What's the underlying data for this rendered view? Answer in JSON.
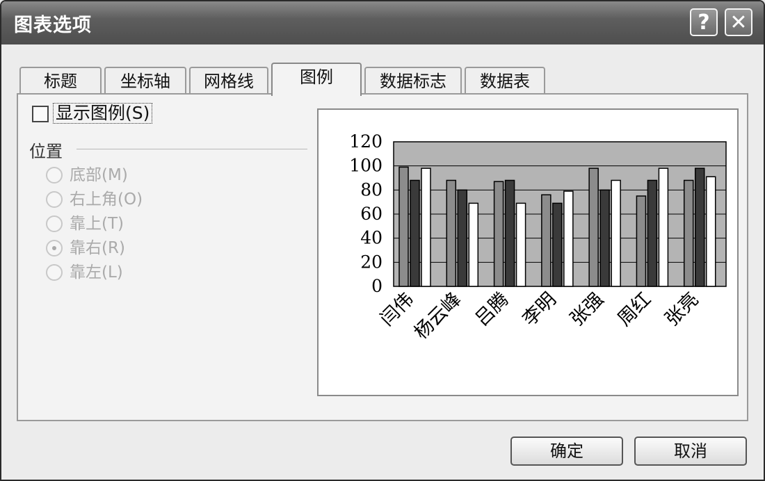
{
  "window": {
    "title": "图表选项",
    "help_glyph": "?",
    "close_glyph": "✕"
  },
  "tabs": [
    {
      "label": "标题"
    },
    {
      "label": "坐标轴"
    },
    {
      "label": "网格线"
    },
    {
      "label": "图例",
      "active": true
    },
    {
      "label": "数据标志"
    },
    {
      "label": "数据表"
    }
  ],
  "legend": {
    "show_label": "显示图例(S)",
    "show_checked": false,
    "position_label": "位置",
    "options": [
      {
        "label": "底部(M)",
        "selected": false
      },
      {
        "label": "右上角(O)",
        "selected": false
      },
      {
        "label": "靠上(T)",
        "selected": false
      },
      {
        "label": "靠右(R)",
        "selected": true
      },
      {
        "label": "靠左(L)",
        "selected": false
      }
    ]
  },
  "chart_data": {
    "type": "bar",
    "categories": [
      "闫伟",
      "杨云峰",
      "吕腾",
      "李明",
      "张强",
      "周红",
      "张亮"
    ],
    "series": [
      {
        "values": [
          99,
          88,
          87,
          76,
          98,
          75,
          88
        ],
        "color": "#8c8c8c"
      },
      {
        "values": [
          88,
          80,
          88,
          69,
          80,
          88,
          98
        ],
        "color": "#3a3a3a"
      },
      {
        "values": [
          98,
          69,
          69,
          79,
          88,
          98,
          91
        ],
        "color": "#ffffff"
      }
    ],
    "ylim": [
      0,
      120
    ],
    "yticks": [
      0,
      20,
      40,
      60,
      80,
      100,
      120
    ],
    "grid": true,
    "plot_area_color": "#b4b4b4",
    "legend": "none"
  },
  "buttons": {
    "ok": "确定",
    "cancel": "取消"
  }
}
